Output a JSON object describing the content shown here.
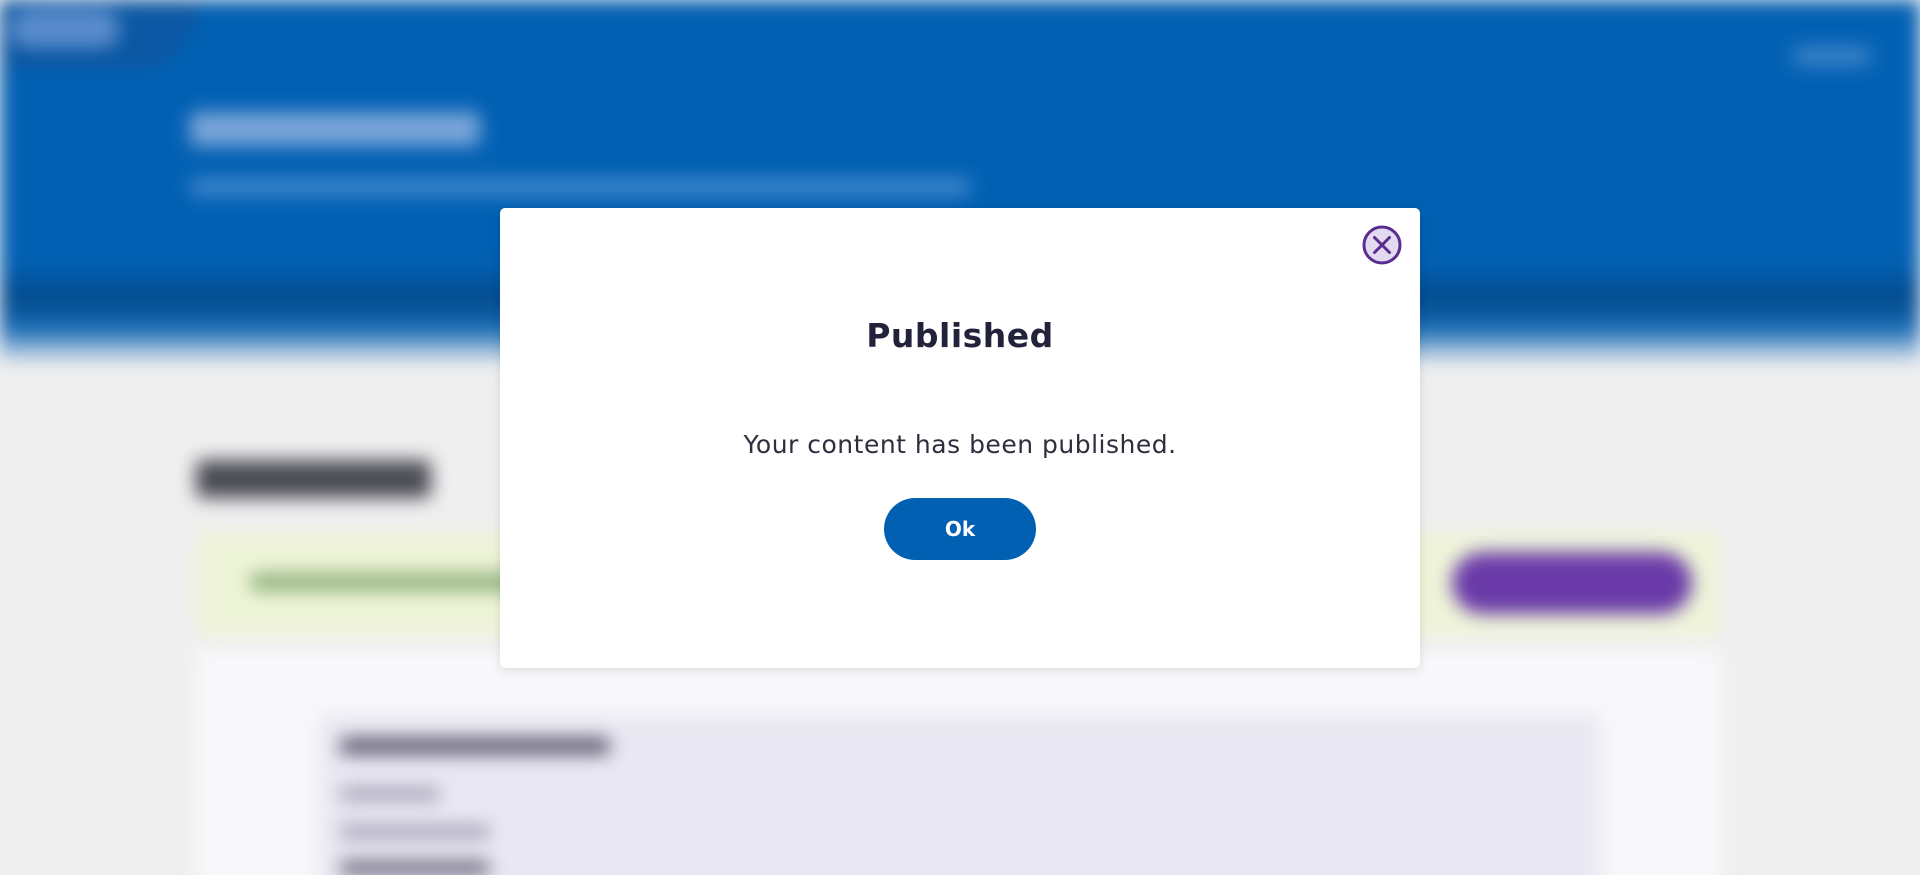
{
  "modal": {
    "title": "Published",
    "message": "Your content has been published.",
    "ok_label": "Ok",
    "close_icon": "close-circle-icon"
  },
  "colors": {
    "brand_blue": "#0260b3",
    "accent_purple": "#6a3aa8",
    "close_icon_purple": "#5b2d90",
    "title_text": "#22223a",
    "modal_background": "#ffffff",
    "page_background": "#efeff0"
  }
}
